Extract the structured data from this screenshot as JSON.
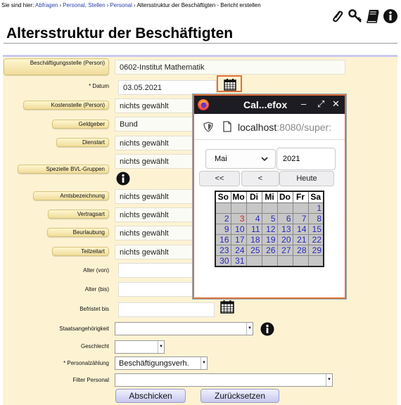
{
  "breadcrumb": {
    "prefix": "Sie sind hier:",
    "items": [
      "Abfragen",
      "Personal, Stellen",
      "Personal"
    ],
    "current": "Altersstruktur der Beschäftigten - Bericht erstellen"
  },
  "toolbar_icons": [
    "paperclip-icon",
    "key-icon",
    "book-icon",
    "info-icon"
  ],
  "page_title": "Altersstruktur der Beschäftigten",
  "form": {
    "beschaeftigungsstelle": {
      "label": "Beschäftigungsstelle (Person)",
      "value": "0602-Institut Mathematik"
    },
    "datum": {
      "label": "* Datum",
      "value": "03.05.2021"
    },
    "kostenstelle": {
      "label": "Kostenstelle (Person)",
      "value": "nichts gewählt"
    },
    "geldgeber": {
      "label": "Geldgeber",
      "value": "Bund"
    },
    "dienstart": {
      "label": "Dienstart",
      "value": "nichts gewählt"
    },
    "bvl_gruppen": {
      "label": "Spezielle BVL-Gruppen",
      "value": "nichts gewählt"
    },
    "amtsbezeichnung": {
      "label": "Amtsbezeichnung",
      "value": "nichts gewählt"
    },
    "vertragsart": {
      "label": "Vertragsart",
      "value": "nichts gewählt"
    },
    "beurlaubung": {
      "label": "Beurlaubung",
      "value": "nichts gewählt"
    },
    "teilzeitart": {
      "label": "Teilzeitart",
      "value": "nichts gewählt"
    },
    "alter_von": {
      "label": "Alter (von)",
      "value": ""
    },
    "alter_bis": {
      "label": "Alter (bis)",
      "value": ""
    },
    "befristet_bis": {
      "label": "Befristet bis",
      "value": ""
    },
    "staatsangehoerigkeit": {
      "label": "Staatsangehörigkeit",
      "value": ""
    },
    "geschlecht": {
      "label": "Geschlecht",
      "value": ""
    },
    "personalzaehlung": {
      "label": "* Personalzählung",
      "value": "Beschäftigungsverh."
    },
    "filter_personal": {
      "label": "Filter Personal",
      "value": ""
    },
    "submit_label": "Abschicken",
    "reset_label": "Zurücksetzen"
  },
  "popup": {
    "title": "Cal...efox",
    "url_host": "localhost",
    "url_rest": ":8080/super:",
    "month": "Mai",
    "year": "2021",
    "prev_year": "<<",
    "prev_month": "<",
    "today": "Heute",
    "weekdays": [
      "So",
      "Mo",
      "Di",
      "Mi",
      "Do",
      "Fr",
      "Sa"
    ],
    "weeks": [
      [
        "",
        "",
        "",
        "",
        "",
        "",
        "1"
      ],
      [
        "2",
        "3",
        "4",
        "5",
        "6",
        "7",
        "8"
      ],
      [
        "9",
        "10",
        "11",
        "12",
        "13",
        "14",
        "15"
      ],
      [
        "16",
        "17",
        "18",
        "19",
        "20",
        "21",
        "22"
      ],
      [
        "23",
        "24",
        "25",
        "26",
        "27",
        "28",
        "29"
      ],
      [
        "30",
        "31",
        "",
        "",
        "",
        "",
        ""
      ]
    ],
    "today_day": "3"
  },
  "colors": {
    "form_bg": "#fdf3d3",
    "label_btn": "#f0dd9b",
    "popup_border": "#e2703a",
    "titlebar": "#1d1c22",
    "link": "#2a3fb0",
    "today": "#d52020"
  }
}
